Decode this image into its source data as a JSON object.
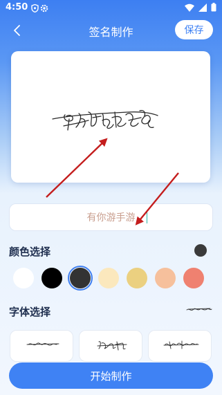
{
  "status_bar": {
    "time": "4:50",
    "icons": [
      "shield-icon",
      "settings-icon",
      "wifi-icon",
      "signal-icon",
      "battery-icon"
    ]
  },
  "header": {
    "title": "签名制作",
    "save_label": "保存",
    "back_icon": "chevron-left-icon"
  },
  "preview": {
    "signature_text": "有你游手游"
  },
  "name_input": {
    "value": "有你游手游",
    "placeholder": ""
  },
  "color_section": {
    "title": "颜色选择",
    "current_color": "#3a3a3a",
    "swatches": [
      {
        "color": "#ffffff",
        "selected": false
      },
      {
        "color": "#000000",
        "selected": false
      },
      {
        "color": "#333333",
        "selected": true
      },
      {
        "color": "#fbe8bd",
        "selected": false
      },
      {
        "color": "#ebd080",
        "selected": false
      },
      {
        "color": "#f6c09c",
        "selected": false
      },
      {
        "color": "#ef8170",
        "selected": false
      }
    ]
  },
  "font_section": {
    "title": "字体选择"
  },
  "start_button_label": "开始制作",
  "colors": {
    "accent": "#3f82f4",
    "arrow": "#c41d1d"
  }
}
